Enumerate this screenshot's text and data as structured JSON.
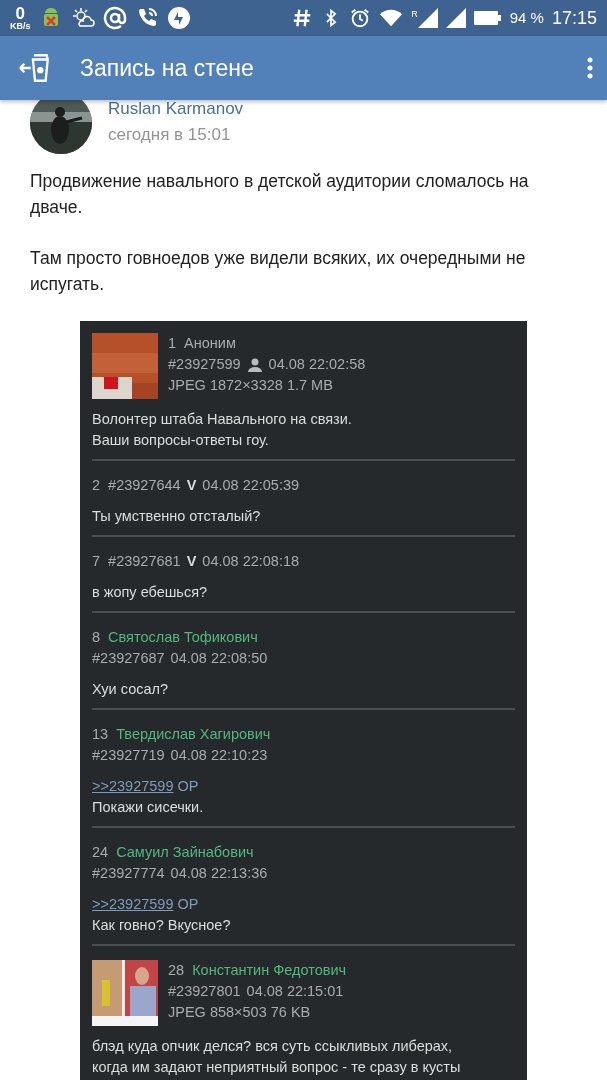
{
  "status_bar": {
    "speed_value": "0",
    "speed_unit": "KB/s",
    "signal_roaming": "R",
    "battery": "94 %",
    "time": "17:15"
  },
  "app_bar": {
    "title": "Запись на стене"
  },
  "post": {
    "author": "Ruslan Karmanov",
    "time": "сегодня в 15:01",
    "paragraphs": [
      "Продвижение навального в детской аудитории сломалось на дваче.",
      "Там просто говноедов уже видели всяких, их очередными не испугать."
    ],
    "screenshot": {
      "posts": [
        {
          "number": "1",
          "name": "Аноним",
          "named": false,
          "id": "#23927599",
          "poster_icon": true,
          "date": "04.08 22:02:58",
          "file": "JPEG 1872×3328 1.7 MB",
          "thumbnail": true,
          "text": [
            "Волонтер штаба Навального на связи.",
            "Ваши вопросы-ответы гоу."
          ]
        },
        {
          "number": "2",
          "id": "#23927644",
          "mark": "V",
          "date": "04.08 22:05:39",
          "text": [
            "Ты умственно отсталый?"
          ]
        },
        {
          "number": "7",
          "id": "#23927681",
          "mark": "V",
          "date": "04.08 22:08:18",
          "text": [
            "в жопу ебешься?"
          ]
        },
        {
          "number": "8",
          "name": "Святослав Тофикович",
          "named": true,
          "id": "#23927687",
          "date": "04.08 22:08:50",
          "text": [
            "Хуи сосал?"
          ]
        },
        {
          "number": "13",
          "name": "Твердислав Хагирович",
          "named": true,
          "id": "#23927719",
          "date": "04.08 22:10:23",
          "reply_link": ">>23927599",
          "reply_tag": "OP",
          "text": [
            "Покажи сисечки."
          ]
        },
        {
          "number": "24",
          "name": "Самуил Зайнабович",
          "named": true,
          "id": "#23927774",
          "date": "04.08 22:13:36",
          "reply_link": ">>23927599",
          "reply_tag": "OP",
          "text": [
            "Как говно? Вкусное?"
          ]
        },
        {
          "number": "28",
          "name": "Константин Федотович",
          "named": true,
          "id": "#23927801",
          "date": "04.08 22:15:01",
          "file": "JPEG 858×503 76 KB",
          "thumbnail": true,
          "text": [
            "блэд куда опчик делся? вся суть ссыкливых либерах,",
            "когда им задают неприятный вопрос - те сразу в кусты"
          ]
        }
      ]
    }
  }
}
